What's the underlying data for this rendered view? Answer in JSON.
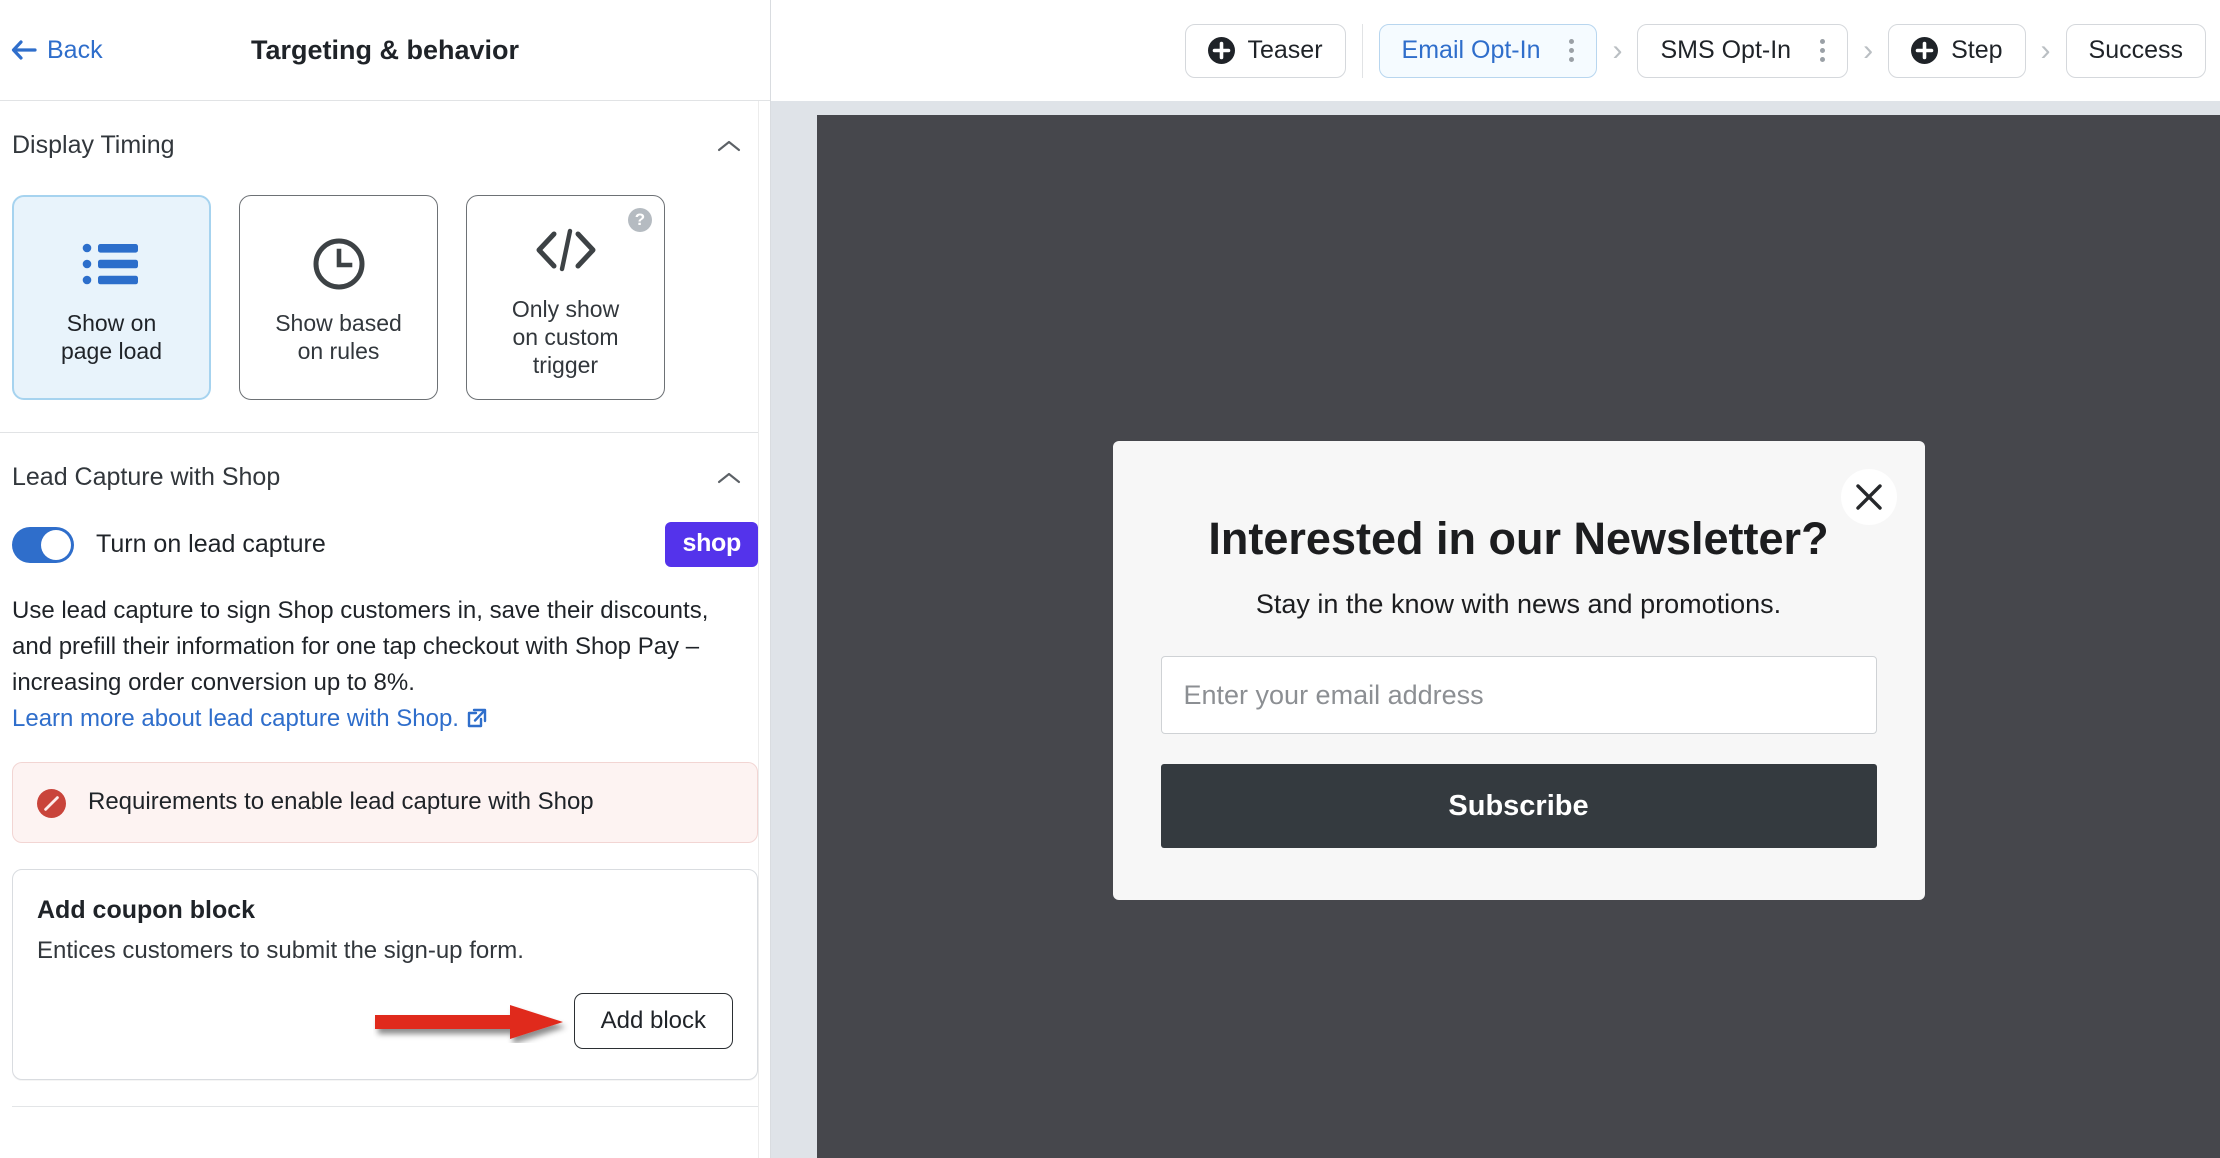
{
  "left_panel": {
    "back_label": "Back",
    "title": "Targeting & behavior",
    "display_timing": {
      "section_title": "Display Timing",
      "cards": [
        {
          "label": "Show on\npage load",
          "icon": "list-icon",
          "selected": true,
          "has_help": false
        },
        {
          "label": "Show based\non rules",
          "icon": "clock-icon",
          "selected": false,
          "has_help": false
        },
        {
          "label": "Only show\non custom\ntrigger",
          "icon": "code-icon",
          "selected": false,
          "has_help": true,
          "help_glyph": "?"
        }
      ]
    },
    "lead_capture": {
      "section_title": "Lead Capture with Shop",
      "toggle_label": "Turn on lead capture",
      "toggle_on": true,
      "shop_badge": "shop",
      "description": "Use lead capture to sign Shop customers in, save their discounts, and prefill their information for one tap checkout with Shop Pay – increasing order conversion up to 8%.",
      "learn_more": "Learn more about lead capture with Shop.",
      "requirement_banner": {
        "text": "Requirements to enable lead capture with Shop",
        "icon": "blocked-icon",
        "bg": "#fdf3f2",
        "border": "#f2d5d3",
        "icon_color": "#c9443b"
      },
      "coupon_card": {
        "title": "Add coupon block",
        "subtitle": "Entices customers to submit the sign-up form.",
        "button_label": "Add block",
        "annotation_arrow": "red-arrow-annotation"
      }
    }
  },
  "topbar": {
    "steps": [
      {
        "label": "Teaser",
        "icon": "plus-circle-icon",
        "active": false,
        "kebab": false
      },
      {
        "label": "Email Opt-In",
        "icon": null,
        "active": true,
        "kebab": true
      },
      {
        "label": "SMS Opt-In",
        "icon": null,
        "active": false,
        "kebab": true
      },
      {
        "label": "Step",
        "icon": "plus-circle-icon",
        "active": false,
        "kebab": false
      },
      {
        "label": "Success",
        "icon": null,
        "active": false,
        "kebab": false
      }
    ],
    "separator_glyph": "›"
  },
  "preview": {
    "canvas_bg": "#46474c",
    "modal": {
      "title": "Interested in our Newsletter?",
      "subtitle": "Stay in the know with news and promotions.",
      "email_placeholder": "Enter your email address",
      "email_value": "",
      "submit_label": "Subscribe",
      "close_icon": "close-icon"
    }
  },
  "colors": {
    "accent_blue": "#2f6ecb",
    "shop_purple": "#5433eb",
    "arrow_red": "#e02b1d",
    "selected_card_bg": "#e8f3fb",
    "modal_button": "#343a3f"
  }
}
